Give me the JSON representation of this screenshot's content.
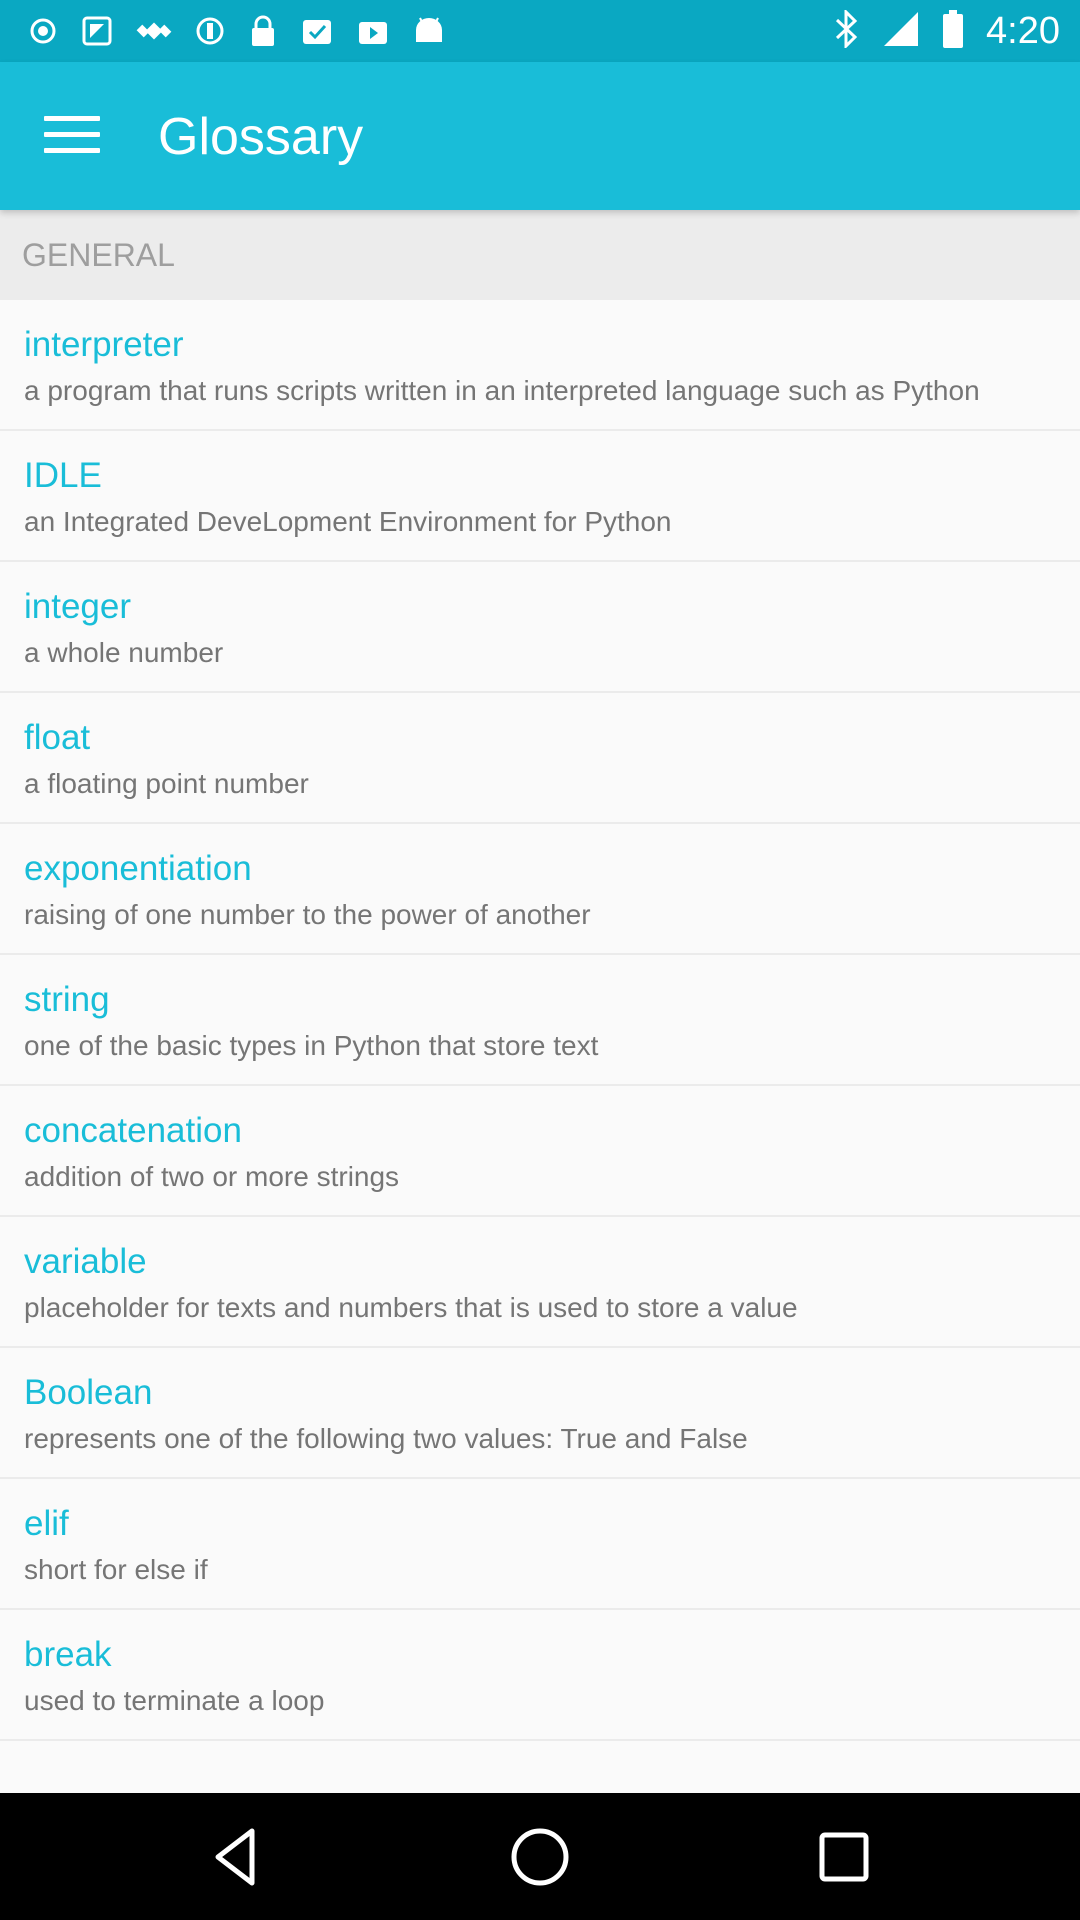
{
  "status_bar": {
    "time": "4:20",
    "left_icons": [
      "notification-dot-icon",
      "fake-gps-icon",
      "satellite-icon",
      "sync-icon",
      "lock-icon",
      "checklist-icon",
      "play-store-icon",
      "android-icon"
    ],
    "right_icons": [
      "bluetooth-icon"
    ]
  },
  "app_bar": {
    "title": "Glossary",
    "menu_icon": "hamburger-menu-icon",
    "background": "#19bdd8"
  },
  "section": {
    "header": "GENERAL"
  },
  "glossary": [
    {
      "term": "interpreter",
      "definition": "a program that runs scripts written in an interpreted language such as Python"
    },
    {
      "term": "IDLE",
      "definition": "an Integrated DeveLopment Environment for Python"
    },
    {
      "term": "integer",
      "definition": "a whole number"
    },
    {
      "term": "float",
      "definition": "a floating point number"
    },
    {
      "term": "exponentiation",
      "definition": "raising of one number to the power of another"
    },
    {
      "term": "string",
      "definition": "one of the basic types in Python that store text"
    },
    {
      "term": "concatenation",
      "definition": "addition of two or more strings"
    },
    {
      "term": "variable",
      "definition": "placeholder for texts and numbers that is used to store a value"
    },
    {
      "term": "Boolean",
      "definition": "represents one of the following two values: True and False"
    },
    {
      "term": "elif",
      "definition": "short for else if"
    },
    {
      "term": "break",
      "definition": "used to terminate a loop"
    }
  ],
  "nav_bar": {
    "buttons": [
      "back-triangle-icon",
      "home-circle-icon",
      "recents-square-icon"
    ]
  },
  "colors": {
    "accent": "#19bdd8",
    "status_bar": "#0aa8c2",
    "definition_text": "#757575",
    "section_header_bg": "#ececec"
  }
}
